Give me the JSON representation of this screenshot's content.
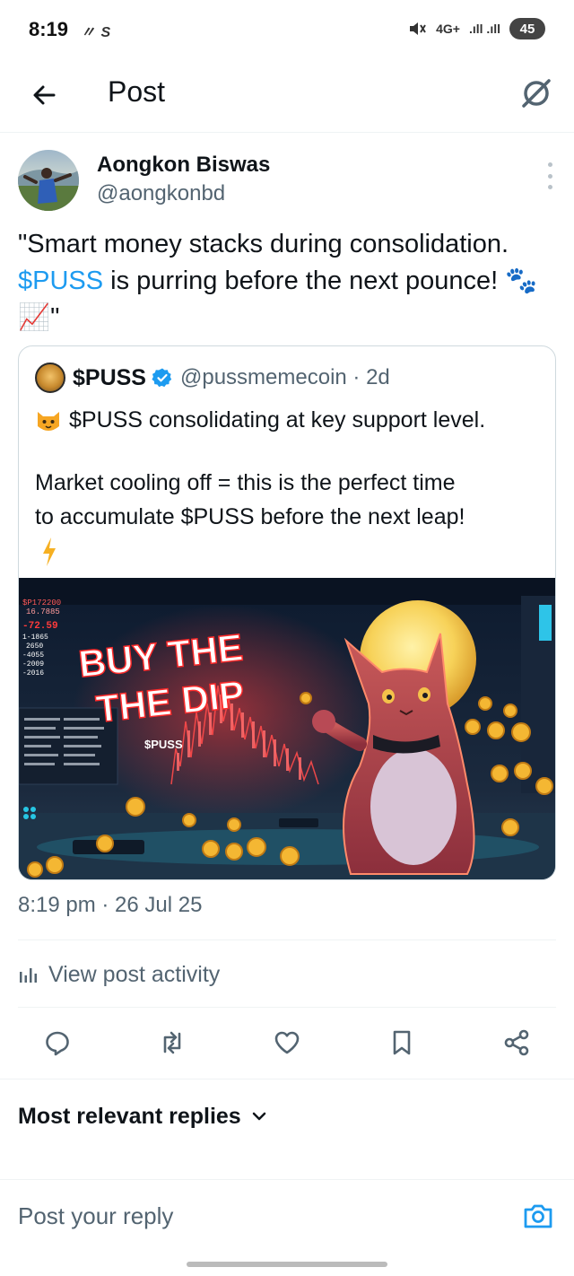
{
  "status_bar": {
    "time": "8:19",
    "left_icons": "〃 S",
    "network": "4G+",
    "signal": ".ıll .ıll",
    "battery": "45"
  },
  "header": {
    "title": "Post",
    "back_icon": "arrow-left-icon",
    "grok_icon": "grok-icon"
  },
  "author": {
    "name": "Aongkon Biswas",
    "handle": "@aongkonbd"
  },
  "post": {
    "text_before": "\"Smart money stacks during consolidation. ",
    "cashtag": "$PUSS",
    "text_after": " is purring before the next pounce! 🐾📈\""
  },
  "quote": {
    "name": "$PUSS",
    "handle": "@pussmemecoin · 2d",
    "line1": "$PUSS consolidating at key support level.",
    "line2": "Market cooling off = this is the perfect time",
    "line3": "to accumulate $PUSS before the next leap!",
    "image": {
      "headline1": "BUY THE",
      "headline2": "THE DIP",
      "tag": "$PUSS",
      "ticker": [
        "$P172200",
        "16.7885",
        "-72.59",
        "1-1865",
        "2650",
        "-4055",
        "-2009",
        "-2016"
      ]
    }
  },
  "timestamp": "8:19 pm · 26 Jul 25",
  "activity_label": "View post activity",
  "actions": [
    "reply-icon",
    "repost-icon",
    "like-icon",
    "bookmark-icon",
    "share-icon"
  ],
  "replies": {
    "sort_label": "Most relevant replies"
  },
  "reply_bar": {
    "placeholder": "Post your reply"
  },
  "colors": {
    "accent": "#1d9bf0",
    "text": "#0f1419",
    "secondary": "#536471",
    "border": "#cfd9de"
  }
}
